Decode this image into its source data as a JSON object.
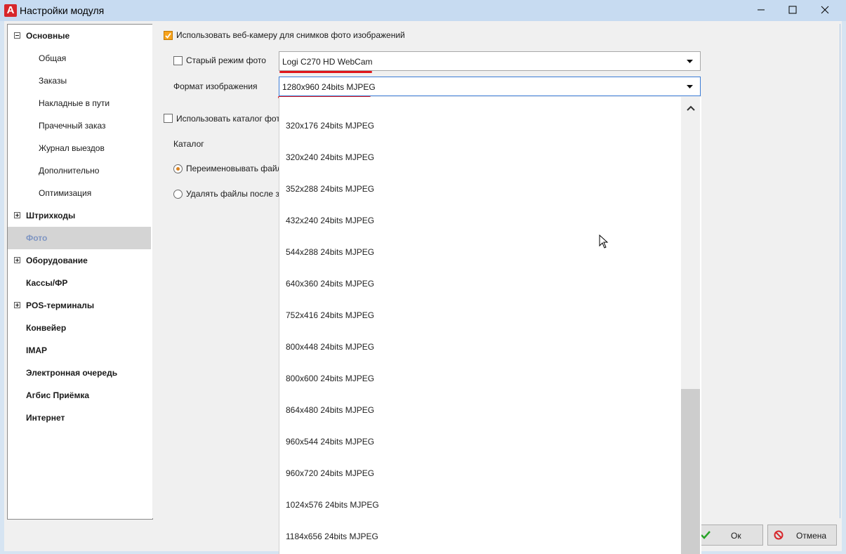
{
  "window": {
    "title": "Настройки модуля",
    "logo_letter": "A"
  },
  "tree": {
    "items": [
      {
        "label": "Основные",
        "level": 0,
        "expander": "minus"
      },
      {
        "label": "Общая",
        "level": 1
      },
      {
        "label": "Заказы",
        "level": 1
      },
      {
        "label": "Накладные в пути",
        "level": 1
      },
      {
        "label": "Прачечный заказ",
        "level": 1
      },
      {
        "label": "Журнал выездов",
        "level": 1
      },
      {
        "label": "Дополнительно",
        "level": 1
      },
      {
        "label": "Оптимизация",
        "level": 1
      },
      {
        "label": "Штрихкоды",
        "level": 0,
        "expander": "plus"
      },
      {
        "label": "Фото",
        "level": 0,
        "selected": true
      },
      {
        "label": "Оборудование",
        "level": 0,
        "expander": "plus"
      },
      {
        "label": "Кассы/ФР",
        "level": 0
      },
      {
        "label": "POS-терминалы",
        "level": 0,
        "expander": "plus"
      },
      {
        "label": "Конвейер",
        "level": 0
      },
      {
        "label": "IMAP",
        "level": 0
      },
      {
        "label": "Электронная очередь",
        "level": 0
      },
      {
        "label": "Агбис Приёмка",
        "level": 0
      },
      {
        "label": "Интернет",
        "level": 0
      }
    ]
  },
  "form": {
    "use_webcam_label": "Использовать веб-камеру для снимков фото изображений",
    "old_photo_mode_label": "Старый режим фото",
    "camera_value": "Logi C270 HD WebCam",
    "image_format_label": "Формат изображения",
    "image_format_value": "1280x960 24bits MJPEG",
    "use_catalog_label": "Использовать каталог фот",
    "catalog_label": "Каталог",
    "rename_files_label": "Переименовывать файл",
    "delete_files_label": "Удалять файлы после за"
  },
  "dropdown": {
    "options": [
      "320x176 24bits MJPEG",
      "320x240 24bits MJPEG",
      "352x288 24bits MJPEG",
      "432x240 24bits MJPEG",
      "544x288 24bits MJPEG",
      "640x360 24bits MJPEG",
      "752x416 24bits MJPEG",
      "800x448 24bits MJPEG",
      "800x600 24bits MJPEG",
      "864x480 24bits MJPEG",
      "960x544 24bits MJPEG",
      "960x720 24bits MJPEG",
      "1024x576 24bits MJPEG",
      "1184x656 24bits MJPEG"
    ]
  },
  "buttons": {
    "ok_label": "Ок",
    "cancel_label": "Отмена"
  },
  "colors": {
    "accent_checkbox": "#f7a31c",
    "ok_icon": "#27a327",
    "cancel_icon": "#d7262b",
    "annotation_underline": "#e0161b"
  }
}
